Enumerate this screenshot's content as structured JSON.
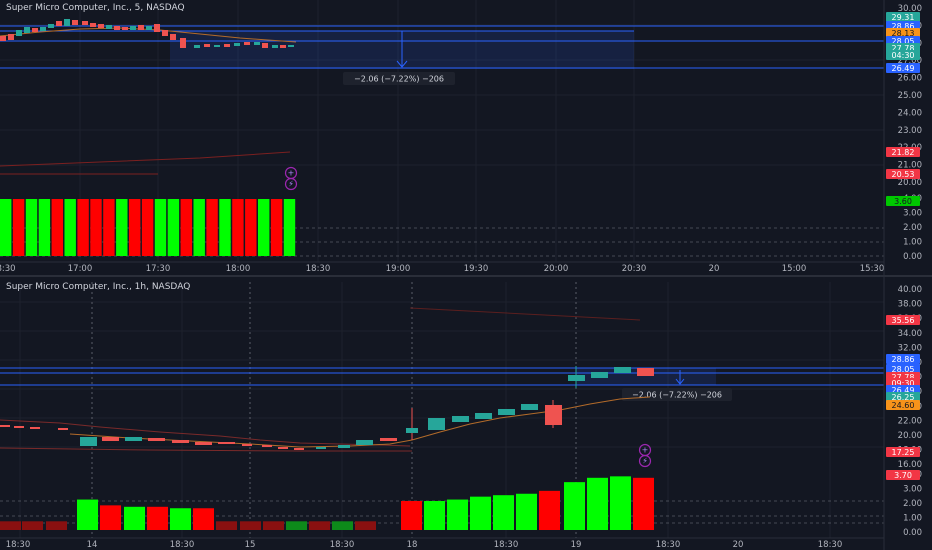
{
  "colors": {
    "background": "#131722",
    "up": "#26a69a",
    "down": "#ef5350",
    "vol_up": "#00ff00",
    "vol_down": "#ff0000",
    "level_line": "#2962ff",
    "text": "#d1d4dc",
    "axis_text": "#b2b5be"
  },
  "top_panel": {
    "title": "Super Micro Computer, Inc., 5, NASDAQ",
    "measure_label": "−2.06 (−7.22%) −206",
    "price_ticks": [
      "30.00",
      "29.00",
      "28.00",
      "27.00",
      "26.00",
      "25.00",
      "24.00",
      "23.00",
      "22.00",
      "21.00",
      "20.00"
    ],
    "osc_ticks": [
      "4.00",
      "3.00",
      "2.00",
      "1.00",
      "0.00"
    ],
    "time_labels": [
      "8:30",
      "17:00",
      "17:30",
      "18:00",
      "18:30",
      "19:00",
      "19:30",
      "20:00",
      "20:30",
      "20",
      "15:00",
      "15:30"
    ],
    "price_tags": [
      {
        "text": "29.31",
        "bg": "#26a69a",
        "fg": "#ffffff"
      },
      {
        "text": "28.86",
        "bg": "#2962ff",
        "fg": "#ffffff"
      },
      {
        "text": "28.13",
        "bg": "#f7931a",
        "fg": "#131722"
      },
      {
        "text": "28.05",
        "bg": "#2962ff",
        "fg": "#ffffff"
      },
      {
        "text": "27.78",
        "bg": "#26a69a",
        "fg": "#ffffff"
      },
      {
        "text": "04:30",
        "bg": "#26a69a",
        "fg": "#ffffff"
      },
      {
        "text": "26.49",
        "bg": "#2962ff",
        "fg": "#ffffff"
      },
      {
        "text": "21.82",
        "bg": "#f23645",
        "fg": "#ffffff"
      },
      {
        "text": "20.53",
        "bg": "#f23645",
        "fg": "#ffffff"
      },
      {
        "text": "3.60",
        "bg": "#00c800",
        "fg": "#131722"
      }
    ],
    "volume_bars": [
      "up",
      "down",
      "up",
      "up",
      "down",
      "up",
      "down",
      "down",
      "down",
      "up",
      "down",
      "down",
      "up",
      "up",
      "down",
      "up",
      "down",
      "up",
      "down",
      "down",
      "up",
      "down",
      "up"
    ]
  },
  "bottom_panel": {
    "title": "Super Micro Computer, Inc., 1h, NASDAQ",
    "measure_label": "−2.06 (−7.22%) −206",
    "price_ticks": [
      "40.00",
      "38.00",
      "36.00",
      "34.00",
      "32.00",
      "30.00",
      "28.00",
      "26.00",
      "24.00",
      "22.00",
      "20.00",
      "18.00",
      "16.00"
    ],
    "osc_ticks": [
      "4.00",
      "3.00",
      "2.00",
      "1.00",
      "0.00"
    ],
    "time_labels": [
      "18:30",
      "14",
      "18:30",
      "15",
      "18:30",
      "18",
      "18:30",
      "19",
      "18:30",
      "20",
      "18:30"
    ],
    "price_tags": [
      {
        "text": "35.56",
        "bg": "#f23645",
        "fg": "#ffffff"
      },
      {
        "text": "28.86",
        "bg": "#2962ff",
        "fg": "#ffffff"
      },
      {
        "text": "28.05",
        "bg": "#2962ff",
        "fg": "#ffffff"
      },
      {
        "text": "27.78",
        "bg": "#f23645",
        "fg": "#ffffff"
      },
      {
        "text": "09:30",
        "bg": "#f23645",
        "fg": "#ffffff"
      },
      {
        "text": "26.49",
        "bg": "#2962ff",
        "fg": "#ffffff"
      },
      {
        "text": "26.25",
        "bg": "#26a69a",
        "fg": "#ffffff"
      },
      {
        "text": "24.60",
        "bg": "#f7931a",
        "fg": "#131722"
      },
      {
        "text": "17.25",
        "bg": "#f23645",
        "fg": "#ffffff"
      },
      {
        "text": "3.70",
        "bg": "#f23645",
        "fg": "#ffffff"
      }
    ],
    "volume_bars": [
      {
        "dir": "down",
        "level": 0.6
      },
      {
        "dir": "down",
        "level": 0.6
      },
      {
        "dir": "down",
        "level": 0.6
      },
      {
        "dir": "up",
        "level": 2.1
      },
      {
        "dir": "down",
        "level": 1.7
      },
      {
        "dir": "up",
        "level": 1.6
      },
      {
        "dir": "down",
        "level": 1.6
      },
      {
        "dir": "up",
        "level": 1.5
      },
      {
        "dir": "down",
        "level": 1.5
      },
      {
        "dir": "down",
        "level": 0.6
      },
      {
        "dir": "down",
        "level": 0.6
      },
      {
        "dir": "down",
        "level": 0.6
      },
      {
        "dir": "up",
        "level": 0.6
      },
      {
        "dir": "down",
        "level": 0.6
      },
      {
        "dir": "up",
        "level": 0.6
      },
      {
        "dir": "down",
        "level": 0.6
      },
      {
        "dir": "down",
        "level": 2.0
      },
      {
        "dir": "up",
        "level": 2.0
      },
      {
        "dir": "up",
        "level": 2.1
      },
      {
        "dir": "up",
        "level": 2.3
      },
      {
        "dir": "up",
        "level": 2.4
      },
      {
        "dir": "up",
        "level": 2.5
      },
      {
        "dir": "down",
        "level": 2.7
      },
      {
        "dir": "up",
        "level": 3.3
      },
      {
        "dir": "up",
        "level": 3.6
      },
      {
        "dir": "up",
        "level": 3.7
      },
      {
        "dir": "down",
        "level": 3.6
      }
    ]
  }
}
